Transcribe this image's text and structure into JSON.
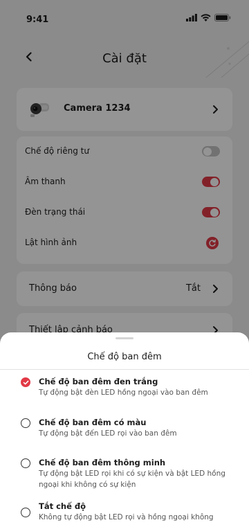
{
  "status_bar": {
    "time": "9:41"
  },
  "header": {
    "title": "Cài đặt"
  },
  "camera": {
    "name": "Camera 1234"
  },
  "settings": {
    "items": [
      {
        "label": "Chế độ riêng tư",
        "control": "toggle",
        "state": "off"
      },
      {
        "label": "Âm thanh",
        "control": "toggle",
        "state": "on"
      },
      {
        "label": "Đèn trạng thái",
        "control": "toggle",
        "state": "on"
      },
      {
        "label": "Lật hình ảnh",
        "control": "rotate-icon"
      }
    ]
  },
  "notifications": {
    "label": "Thông báo",
    "value": "Tắt"
  },
  "alerts": {
    "label": "Thiết lập cảnh báo"
  },
  "sheet": {
    "title": "Chế độ ban đêm",
    "options": [
      {
        "title": "Chế độ ban đêm đen trắng",
        "description": "Tự động bật đèn LED hồng ngoại vào ban đêm",
        "selected": true
      },
      {
        "title": "Chế độ ban đêm có màu",
        "description": "Tự động bật đến LED rọi vào ban đêm",
        "selected": false
      },
      {
        "title": "Chế độ ban đêm thông minh",
        "description": "Tự động bật LED rọi khi có sự kiện và bật LED hồng ngoại khi không có sự kiện",
        "selected": false
      },
      {
        "title": "Tắt chế độ",
        "description": "Không tự động bật LED rọi và hồng ngoại không",
        "selected": false
      }
    ]
  },
  "colors": {
    "accent": "#e23a47",
    "toggle_off": "#c4c4c4",
    "background": "#efefef"
  }
}
